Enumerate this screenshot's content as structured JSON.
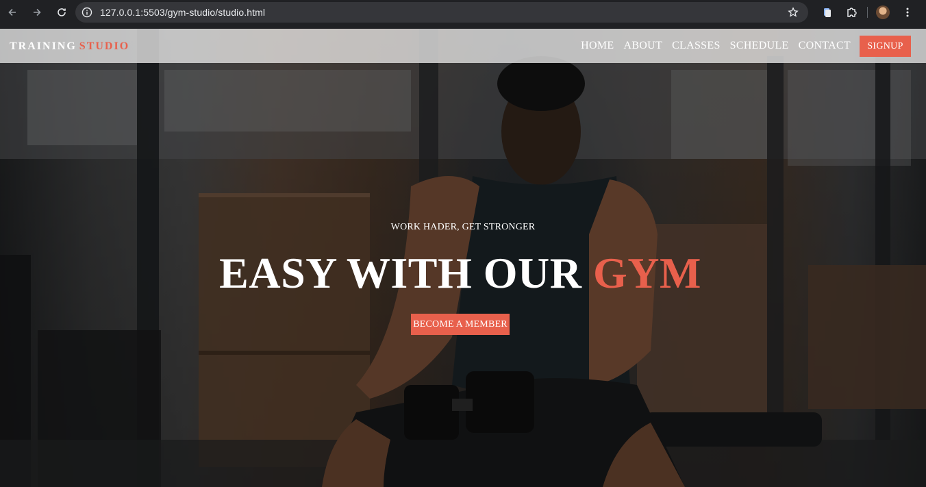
{
  "browser": {
    "url": "127.0.0.1:5503/gym-studio/studio.html",
    "icons": [
      "back-arrow-icon",
      "forward-arrow-icon",
      "reload-icon",
      "site-info-icon",
      "bookmark-star-icon",
      "extension-icon",
      "puzzle-icon",
      "profile-avatar",
      "kebab-menu-icon"
    ]
  },
  "header": {
    "logo_main": "TRAINING",
    "logo_accent": "STUDIO",
    "nav": [
      "HOME",
      "ABOUT",
      "CLASSES",
      "SCHEDULE",
      "CONTACT"
    ],
    "signup_label": "SIGNUP"
  },
  "hero": {
    "tagline": "WORK HADER, GET STRONGER",
    "headline_main": "EASY WITH OUR",
    "headline_accent": "GYM",
    "cta_label": "BECOME A MEMBER"
  },
  "colors": {
    "accent": "#e8604c",
    "header_bg": "#ebebeb",
    "chrome_bg": "#202124",
    "omnibox_bg": "#35363a"
  }
}
